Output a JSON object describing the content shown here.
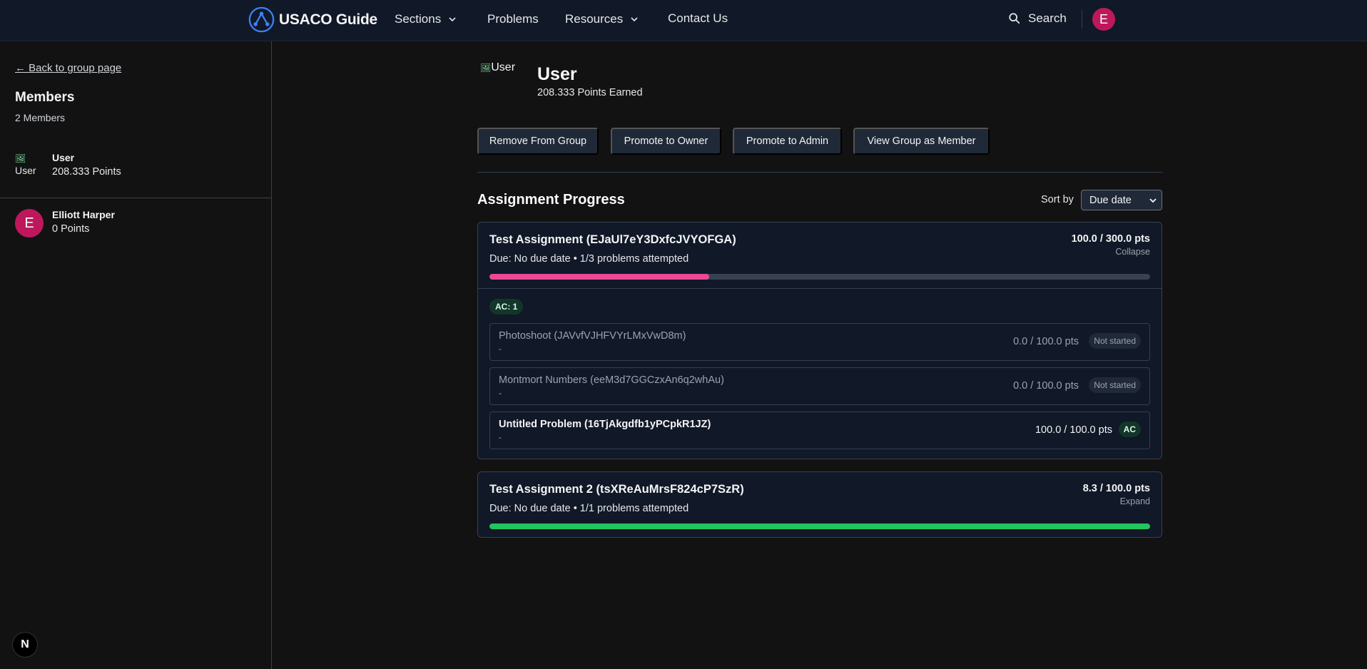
{
  "nav": {
    "brand": "USACO Guide",
    "sections": "Sections",
    "problems": "Problems",
    "resources": "Resources",
    "contact": "Contact Us",
    "search": "Search",
    "avatar_initial": "E",
    "colors": {
      "bg": "#111827",
      "avatar": "#be185d",
      "logo": "#3b82f6"
    }
  },
  "sidebar": {
    "back_link": "← Back to group page",
    "title": "Members",
    "count": "2 Members",
    "members": [
      {
        "name": "User",
        "points": "208.333 Points",
        "image_alt": "User"
      },
      {
        "name": "Elliott Harper",
        "points": "0 Points",
        "initial": "E"
      }
    ],
    "next_badge": "N"
  },
  "profile": {
    "image_alt": "User",
    "name": "User",
    "points": "208.333 Points Earned"
  },
  "actions": {
    "remove": "Remove From Group",
    "promote_owner": "Promote to Owner",
    "promote_admin": "Promote to Admin",
    "view_as_member": "View Group as Member"
  },
  "progress_section": {
    "title": "Assignment Progress",
    "sort_label": "Sort by",
    "sort_value": "Due date"
  },
  "assignments": [
    {
      "title": "Test Assignment (EJaUl7eY3DxfcJVYOFGA)",
      "subtitle": "Due: No due date • 1/3 problems attempted",
      "points": "100.0 / 300.0 pts",
      "toggle": "Collapse",
      "progress": 0.333,
      "progress_color": "#ec4899",
      "ac_count": "AC: 1",
      "problems": [
        {
          "title": "Photoshoot (JAVvfVJHFVYrLMxVwD8m)",
          "dash": "-",
          "points": "0.0 / 100.0 pts",
          "status": "Not started"
        },
        {
          "title": "Montmort Numbers (eeM3d7GGCzxAn6q2whAu)",
          "dash": "-",
          "points": "0.0 / 100.0 pts",
          "status": "Not started"
        },
        {
          "title": "Untitled Problem (16TjAkgdfb1yPCpkR1JZ)",
          "dash": "-",
          "points": "100.0 / 100.0 pts",
          "status": "AC"
        }
      ]
    },
    {
      "title": "Test Assignment 2 (tsXReAuMrsF824cP7SzR)",
      "subtitle": "Due: No due date • 1/1 problems attempted",
      "points": "8.3 / 100.0 pts",
      "toggle": "Expand",
      "progress": 1.0,
      "progress_color": "#22c55e"
    }
  ]
}
